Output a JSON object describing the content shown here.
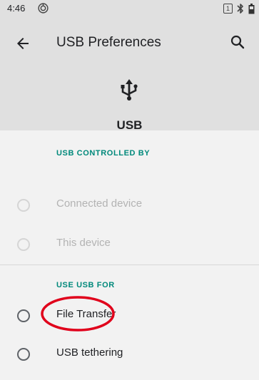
{
  "status_bar": {
    "time": "4:46",
    "sim_badge": "1",
    "icons": [
      "do-not-disturb-icon",
      "bluetooth-icon",
      "battery-icon"
    ]
  },
  "toolbar": {
    "title": "USB Preferences",
    "back_icon": "arrow-back-icon",
    "search_icon": "search-icon"
  },
  "hero": {
    "icon": "usb-icon",
    "label": "USB"
  },
  "sections": [
    {
      "header": "USB CONTROLLED BY",
      "options": [
        {
          "label": "Connected device",
          "enabled": false,
          "selected": false
        },
        {
          "label": "This device",
          "enabled": false,
          "selected": false
        }
      ]
    },
    {
      "header": "USE USB FOR",
      "options": [
        {
          "label": "File Transfer",
          "enabled": true,
          "selected": false
        },
        {
          "label": "USB tethering",
          "enabled": true,
          "selected": false
        }
      ]
    }
  ],
  "annotation": {
    "highlight_color": "#e0001b",
    "highlighted_option": "File Transfer"
  },
  "colors": {
    "accent": "#00897b",
    "header_bg": "#e0e0e0",
    "page_bg": "#f2f2f2"
  }
}
